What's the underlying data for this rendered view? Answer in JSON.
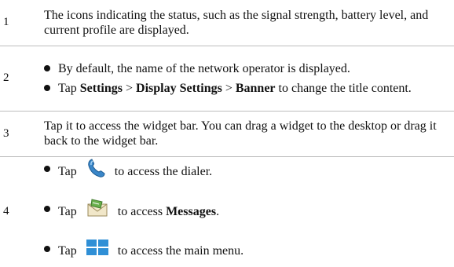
{
  "rows": [
    {
      "num": "1",
      "text": "The icons indicating the status, such as the signal strength, battery level, and current profile are displayed."
    },
    {
      "num": "2",
      "bullet1": "By default, the name of the network operator is displayed.",
      "bullet2": {
        "tap": "Tap",
        "settings": "Settings",
        "sep1": ">",
        "display_settings": "Display Settings",
        "sep2": ">",
        "banner": "Banner",
        "rest": "to change the title content."
      }
    },
    {
      "num": "3",
      "text": "Tap it to access the widget bar. You can drag a widget to the desktop or drag it back to the widget bar."
    },
    {
      "num": "4",
      "items": [
        {
          "tap": "Tap",
          "icon": "phone-icon",
          "rest": "to access the dialer."
        },
        {
          "tap": "Tap",
          "icon": "messages-icon",
          "rest_pre": "to access",
          "bold": "Messages",
          "rest_post": "."
        },
        {
          "tap": "Tap",
          "icon": "main-menu-icon",
          "rest": "to access the main menu."
        }
      ]
    }
  ]
}
